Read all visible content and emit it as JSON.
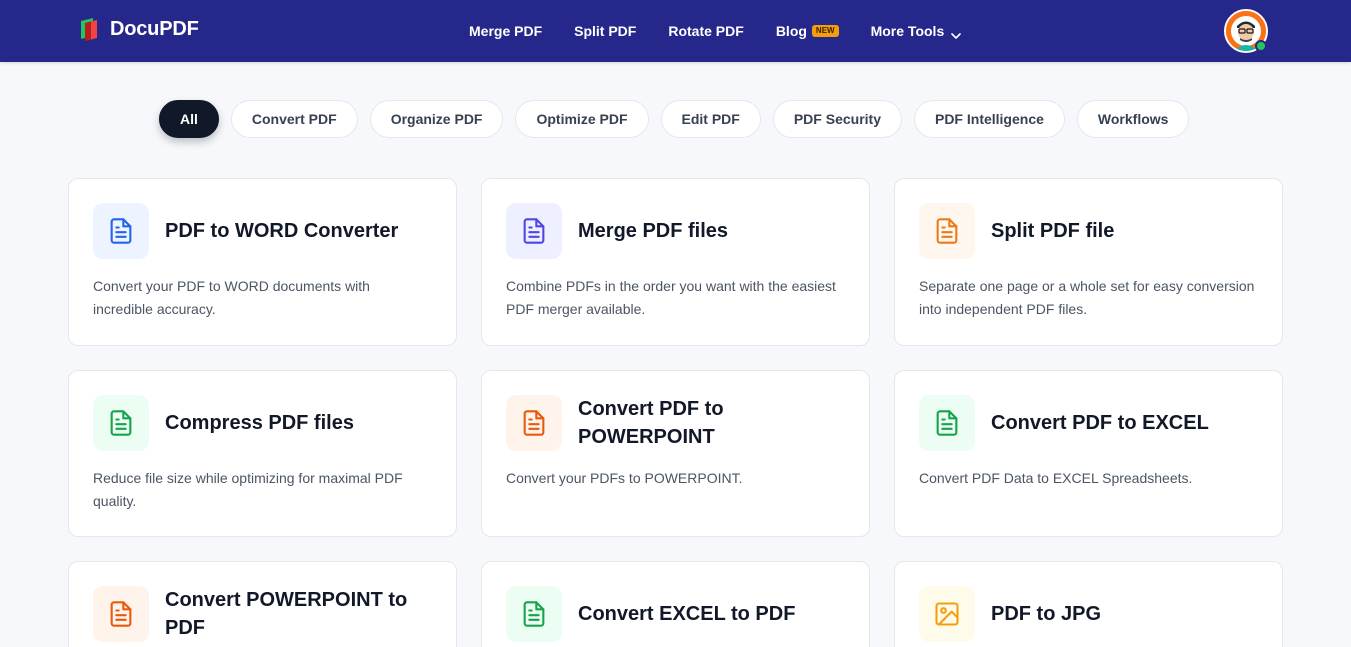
{
  "brand": {
    "name": "DocuPDF"
  },
  "nav": {
    "items": [
      {
        "label": "Merge PDF"
      },
      {
        "label": "Split PDF"
      },
      {
        "label": "Rotate PDF"
      },
      {
        "label": "Blog",
        "badge": "NEW"
      },
      {
        "label": "More Tools"
      }
    ]
  },
  "filters": [
    "All",
    "Convert PDF",
    "Organize PDF",
    "Optimize PDF",
    "Edit PDF",
    "PDF Security",
    "PDF Intelligence",
    "Workflows"
  ],
  "active_filter": "All",
  "cards": [
    {
      "title": "PDF to WORD Converter",
      "desc": "Convert your PDF to WORD documents with incredible accuracy.",
      "icon": "document-icon",
      "color": "#2563eb",
      "bg": "#eef4ff"
    },
    {
      "title": "Merge PDF files",
      "desc": "Combine PDFs in the order you want with the easiest PDF merger available.",
      "icon": "document-icon",
      "color": "#4f46e5",
      "bg": "#eef0ff"
    },
    {
      "title": "Split PDF file",
      "desc": "Separate one page or a whole set for easy conversion into independent PDF files.",
      "icon": "document-icon",
      "color": "#ea7a1a",
      "bg": "#fff7ed"
    },
    {
      "title": "Compress PDF files",
      "desc": "Reduce file size while optimizing for maximal PDF quality.",
      "icon": "document-icon",
      "color": "#16a34a",
      "bg": "#ecfdf3"
    },
    {
      "title": "Convert PDF to POWERPOINT",
      "desc": "Convert your PDFs to POWERPOINT.",
      "icon": "document-icon",
      "color": "#ea580c",
      "bg": "#fff4ec"
    },
    {
      "title": "Convert PDF to EXCEL",
      "desc": "Convert PDF Data to EXCEL Spreadsheets.",
      "icon": "document-icon",
      "color": "#16a34a",
      "bg": "#ecfdf3"
    },
    {
      "title": "Convert POWERPOINT to PDF",
      "desc": "",
      "icon": "document-icon",
      "color": "#ea580c",
      "bg": "#fff4ec"
    },
    {
      "title": "Convert EXCEL to PDF",
      "desc": "",
      "icon": "document-icon",
      "color": "#16a34a",
      "bg": "#ecfdf3"
    },
    {
      "title": "PDF to JPG",
      "desc": "",
      "icon": "image-icon",
      "color": "#f59e0b",
      "bg": "#fffbeb"
    }
  ]
}
